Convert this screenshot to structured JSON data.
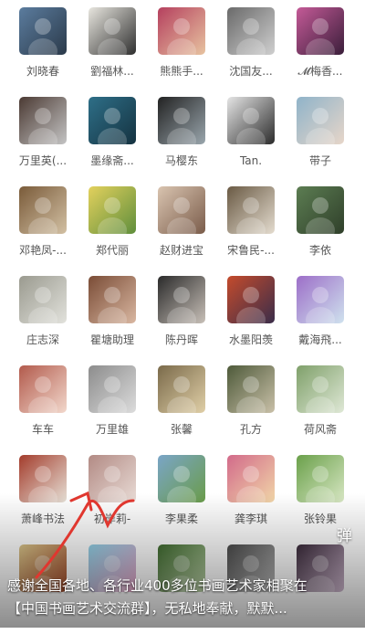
{
  "members": [
    {
      "name": "刘晓春",
      "palette": [
        "#5b7c9e",
        "#2b3a4a"
      ]
    },
    {
      "name": "劉福林...",
      "palette": [
        "#e8e6df",
        "#2f2f2f"
      ]
    },
    {
      "name": "熊熊手...",
      "palette": [
        "#b5405e",
        "#e7c3a0"
      ]
    },
    {
      "name": "沈国友...",
      "palette": [
        "#6a6a6a",
        "#cfcfcf"
      ]
    },
    {
      "name": "𝓜梅香...",
      "palette": [
        "#c45a97",
        "#3a1e3a"
      ]
    },
    {
      "name": "万里英(...",
      "palette": [
        "#4b3a33",
        "#c4c4c4"
      ]
    },
    {
      "name": "墨缘斋...",
      "palette": [
        "#2e6f88",
        "#153240"
      ]
    },
    {
      "name": "马樱东",
      "palette": [
        "#222222",
        "#9aa6ad"
      ]
    },
    {
      "name": "Tan.",
      "palette": [
        "#e5e5e5",
        "#2b2b2b"
      ]
    },
    {
      "name": "带子",
      "palette": [
        "#8fb3c9",
        "#e7d6c9"
      ]
    },
    {
      "name": "邓艳凤-...",
      "palette": [
        "#7a5b3a",
        "#d2c0a3"
      ]
    },
    {
      "name": "郑代丽",
      "palette": [
        "#e3d15d",
        "#5f8e3c"
      ]
    },
    {
      "name": "赵财进宝",
      "palette": [
        "#d9c4b0",
        "#7a5c4a"
      ]
    },
    {
      "name": "宋鲁民-...",
      "palette": [
        "#6a5a44",
        "#e4dccf"
      ]
    },
    {
      "name": "李依",
      "palette": [
        "#5c7d52",
        "#2f3f2a"
      ]
    },
    {
      "name": "庄志深",
      "palette": [
        "#9a9a8f",
        "#e2e2dc"
      ]
    },
    {
      "name": "瞿塘助理",
      "palette": [
        "#7a4c36",
        "#d9b7a1"
      ]
    },
    {
      "name": "陈丹晖",
      "palette": [
        "#2a2a2a",
        "#c8c0b8"
      ]
    },
    {
      "name": "水墨阳羡",
      "palette": [
        "#c44b2c",
        "#3a2d4a"
      ]
    },
    {
      "name": "戴海飛...",
      "palette": [
        "#9c6ec8",
        "#cfe2ee"
      ]
    },
    {
      "name": "车车",
      "palette": [
        "#b25a4c",
        "#f2d8cc"
      ]
    },
    {
      "name": "万里雄",
      "palette": [
        "#8c8c8c",
        "#dcdcdc"
      ]
    },
    {
      "name": "张馨",
      "palette": [
        "#7a6a4a",
        "#e0cfa7"
      ]
    },
    {
      "name": "孔方",
      "palette": [
        "#4e5a3a",
        "#c9c0a8"
      ]
    },
    {
      "name": "荷风斋",
      "palette": [
        "#7fa06a",
        "#dfe8d6"
      ]
    },
    {
      "name": "萧峰书法",
      "palette": [
        "#a33c2c",
        "#e6e0d6"
      ]
    },
    {
      "name": "初岸莉-",
      "palette": [
        "#b28a84",
        "#e9dcd6"
      ]
    },
    {
      "name": "李果柔",
      "palette": [
        "#7aa5c7",
        "#6a9c4a"
      ]
    },
    {
      "name": "龚李琪",
      "palette": [
        "#d26a8a",
        "#f1d6a8"
      ]
    },
    {
      "name": "张铃果",
      "palette": [
        "#6aa04a",
        "#d8e7c4"
      ]
    },
    {
      "name": "",
      "palette": [
        "#d9c58a",
        "#a24a2c"
      ]
    },
    {
      "name": "",
      "palette": [
        "#8fd0e6",
        "#e7a4c6"
      ]
    },
    {
      "name": "",
      "palette": [
        "#3f6b2f",
        "#bcd2a8"
      ]
    },
    {
      "name": "",
      "palette": [
        "#4a4a4a",
        "#bdbdbd"
      ]
    },
    {
      "name": "",
      "palette": [
        "#3a2a3a",
        "#cfb8cf"
      ]
    }
  ],
  "overlay": {
    "danmaku": "弹",
    "caption_line1": "感谢全国各地、各行业400多位书画艺术家相聚在",
    "caption_line2": "【中国书画艺术交流群】，无私地奉献，默默..."
  },
  "colors": {
    "name_text": "#555555",
    "annotation_stroke": "#e0372f"
  }
}
